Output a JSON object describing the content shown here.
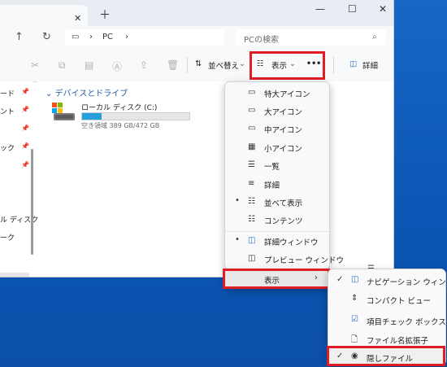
{
  "titlebar": {
    "close_glyph": "✕",
    "newtab_glyph": "＋",
    "minimize_glyph": "—",
    "maximize_glyph": "☐"
  },
  "address": {
    "path": "PC",
    "search_placeholder": "PCの検索"
  },
  "toolbar": {
    "sort_label": "並べ替え",
    "view_label": "表示",
    "more_label": "•••",
    "details_label": "詳細"
  },
  "sidebar": {
    "items": [
      "ード",
      "ント",
      "",
      "ック",
      "",
      "",
      "ル ディスク",
      "ーク"
    ]
  },
  "content": {
    "section_title": "デバイスとドライブ",
    "drive_name": "ローカル ディスク (C:)",
    "drive_space": "空き領域 389 GB/472 GB",
    "drive_usage_fraction": 0.18
  },
  "view_menu": {
    "items": [
      {
        "icon": "▭",
        "label": "特大アイコン",
        "marker": ""
      },
      {
        "icon": "▭",
        "label": "大アイコン",
        "marker": ""
      },
      {
        "icon": "▭",
        "label": "中アイコン",
        "marker": ""
      },
      {
        "icon": "▦",
        "label": "小アイコン",
        "marker": ""
      },
      {
        "icon": "☰",
        "label": "一覧",
        "marker": ""
      },
      {
        "icon": "≡",
        "label": "詳細",
        "marker": ""
      },
      {
        "icon": "☷",
        "label": "並べて表示",
        "marker": "•"
      },
      {
        "icon": "☷",
        "label": "コンテンツ",
        "marker": ""
      }
    ],
    "pane_items": [
      {
        "icon": "◫",
        "label": "詳細ウィンドウ",
        "marker": "•"
      },
      {
        "icon": "◫",
        "label": "プレビュー ウィンドウ",
        "marker": ""
      }
    ],
    "show_label": "表示",
    "show_chevron": "›"
  },
  "show_submenu": {
    "items": [
      {
        "icon": "◫",
        "label": "ナビゲーション ウィンドウ",
        "check": "✓"
      },
      {
        "icon": "⇕",
        "label": "コンパクト ビュー",
        "check": ""
      },
      {
        "icon": "☑",
        "label": "項目チェック ボックス",
        "check": ""
      },
      {
        "icon": "🗋",
        "label": "ファイル名拡張子",
        "check": ""
      },
      {
        "icon": "◉",
        "label": "隠しファイル",
        "check": "✓"
      }
    ]
  },
  "colors": {
    "highlight": "#e01c24",
    "accent": "#26a0da",
    "desktop": "#0b5ab8"
  }
}
